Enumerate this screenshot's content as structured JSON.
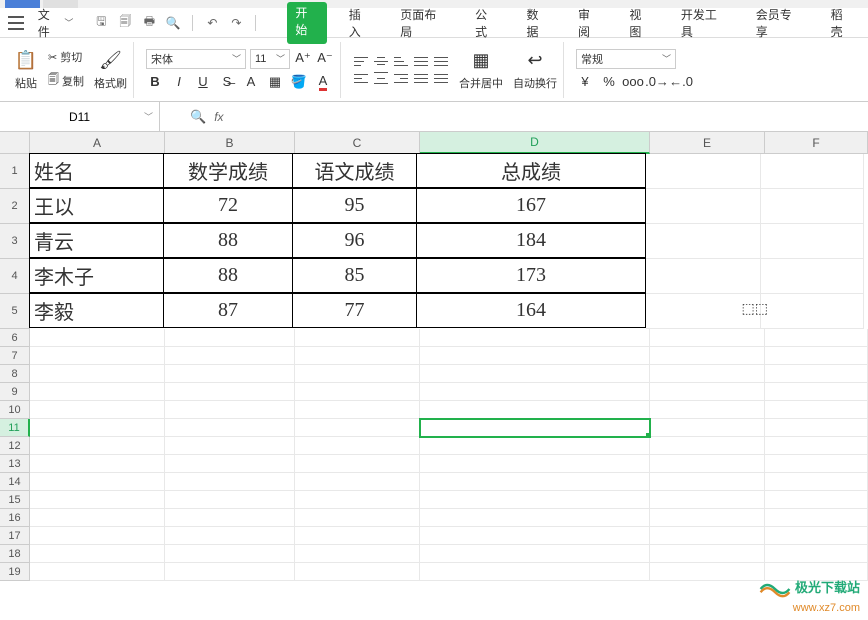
{
  "menu": {
    "file": "文件",
    "tabs": [
      "开始",
      "插入",
      "页面布局",
      "公式",
      "数据",
      "审阅",
      "视图",
      "开发工具",
      "会员专享",
      "稻壳"
    ]
  },
  "ribbon": {
    "paste": "粘贴",
    "cut": "剪切",
    "copy": "复制",
    "format_painter": "格式刷",
    "font_name": "宋体",
    "font_size": "11",
    "merge_center": "合并居中",
    "wrap_text": "自动换行",
    "number_format": "常规",
    "currency_symbol": "¥"
  },
  "namebox": {
    "value": "D11"
  },
  "formula": {
    "fx": "fx"
  },
  "columns": [
    "A",
    "B",
    "C",
    "D",
    "E",
    "F"
  ],
  "data_rows": [
    {
      "h": "1",
      "A": "姓名",
      "B": "数学成绩",
      "C": "语文成绩",
      "D": "总成绩"
    },
    {
      "h": "2",
      "A": "王以",
      "B": "72",
      "C": "95",
      "D": "167"
    },
    {
      "h": "3",
      "A": "青云",
      "B": "88",
      "C": "96",
      "D": "184"
    },
    {
      "h": "4",
      "A": "李木子",
      "B": "88",
      "C": "85",
      "D": "173"
    },
    {
      "h": "5",
      "A": "李毅",
      "B": "87",
      "C": "77",
      "D": "164"
    }
  ],
  "empty_rows": [
    "6",
    "7",
    "8",
    "9",
    "10",
    "11",
    "12",
    "13",
    "14",
    "15",
    "16",
    "17",
    "18",
    "19"
  ],
  "selected": {
    "row": "11",
    "col": "D"
  },
  "watermark": {
    "line1": "极光下载站",
    "line2": "www.xz7.com"
  }
}
